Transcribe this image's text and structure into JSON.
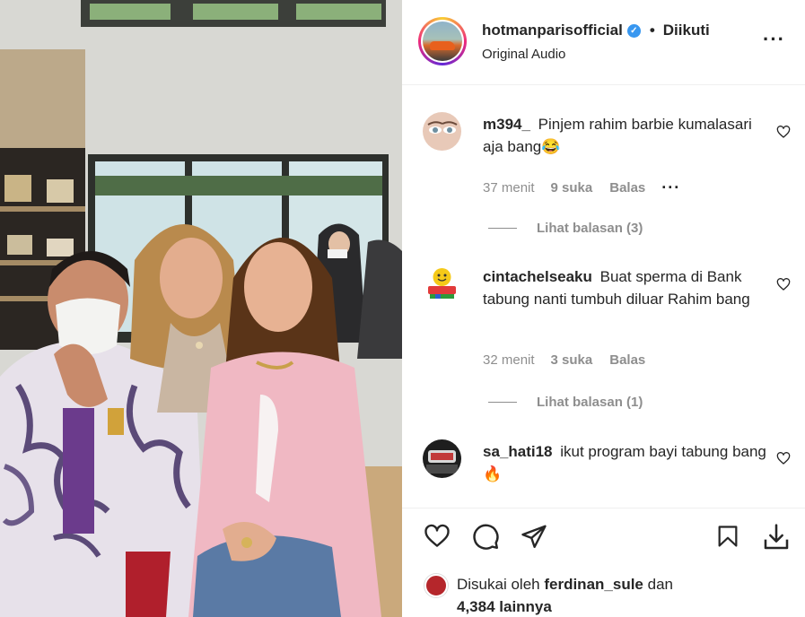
{
  "post": {
    "username": "hotmanparisofficial",
    "follow_state": "Diikuti",
    "separator": "•",
    "audio": "Original Audio"
  },
  "comments": [
    {
      "user": "m394_",
      "text": "Pinjem rahim barbie kumalasari aja bang😂",
      "time": "37 menit",
      "likes": "9 suka",
      "reply": "Balas",
      "view_replies": "Lihat balasan (3)"
    },
    {
      "user": "cintachelseaku",
      "text": "Buat sperma di Bank tabung nanti tumbuh diluar Rahim bang",
      "time": "32 menit",
      "likes": "3 suka",
      "reply": "Balas",
      "view_replies": "Lihat balasan (1)"
    },
    {
      "user": "sa_hati18",
      "text": "ikut program bayi tabung bang🔥"
    }
  ],
  "liked_by": {
    "prefix": "Disukai oleh",
    "user": "ferdinan_sule",
    "connector": "dan",
    "others": "4,384 lainnya"
  },
  "icons": {
    "verified": "verified-badge-icon",
    "more": "more-options-icon",
    "heart": "heart-icon",
    "comment": "comment-icon",
    "share": "share-icon",
    "save": "bookmark-icon",
    "download": "download-icon"
  },
  "colors": {
    "text": "#262626",
    "muted": "#8e8e8e",
    "verified": "#3897f0",
    "border": "#efefef"
  }
}
